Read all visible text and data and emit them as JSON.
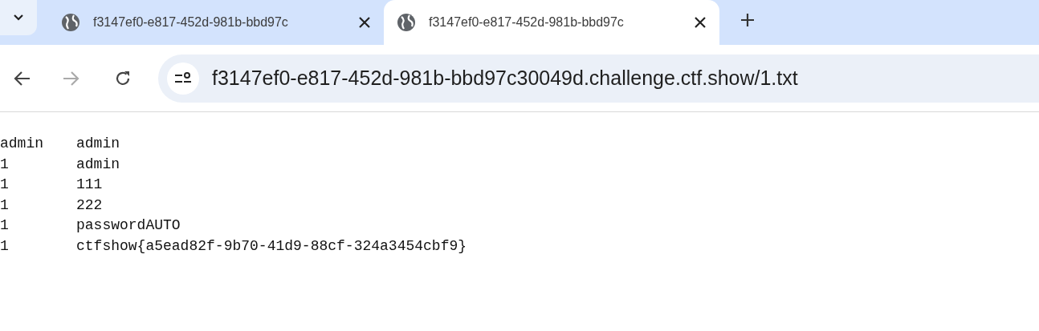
{
  "tabs": [
    {
      "title": "f3147ef0-e817-452d-981b-bbd97c",
      "selected": false
    },
    {
      "title": "f3147ef0-e817-452d-981b-bbd97c",
      "selected": true
    }
  ],
  "address_bar": {
    "url": "f3147ef0-e817-452d-981b-bbd97c30049d.challenge.ctf.show/1.txt"
  },
  "navigation": {
    "forward_disabled": true
  },
  "file_lines": [
    {
      "column_1": "admin",
      "column_2": "admin"
    },
    {
      "column_1": "1",
      "column_2": "admin"
    },
    {
      "column_1": "1",
      "column_2": "111"
    },
    {
      "column_1": "1",
      "column_2": "222"
    },
    {
      "column_1": "1",
      "column_2": "passwordAUTO"
    },
    {
      "column_1": "1",
      "column_2": "ctfshow{a5ead82f-9b70-41d9-88cf-324a3454cbf9}"
    }
  ]
}
